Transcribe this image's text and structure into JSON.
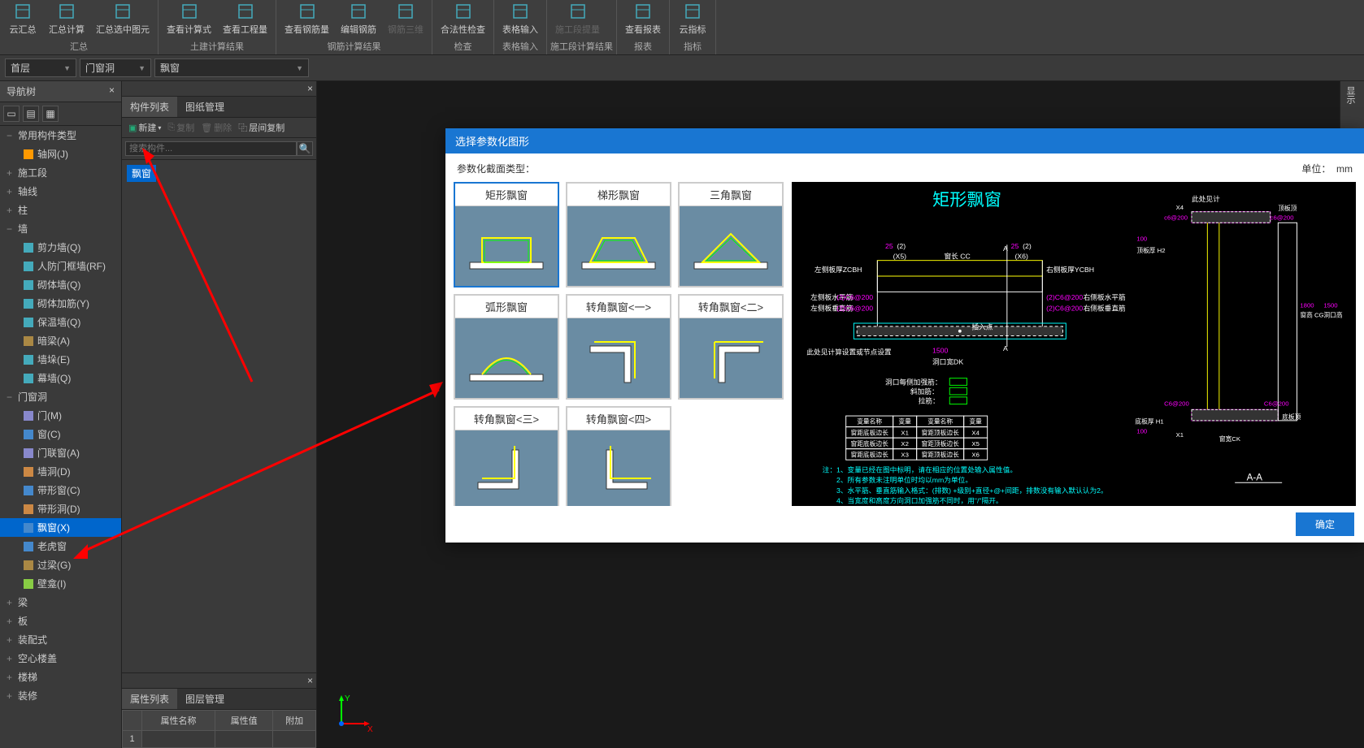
{
  "ribbon": {
    "groups": [
      {
        "label": "汇总",
        "buttons": [
          {
            "label": "云汇总",
            "icon": "cloud"
          },
          {
            "label": "汇总计算",
            "icon": "calc"
          },
          {
            "label": "汇总选中图元",
            "icon": "select"
          }
        ]
      },
      {
        "label": "土建计算结果",
        "buttons": [
          {
            "label": "查看计算式",
            "icon": "view"
          },
          {
            "label": "查看工程量",
            "icon": "view"
          }
        ]
      },
      {
        "label": "钢筋计算结果",
        "buttons": [
          {
            "label": "查看钢筋量",
            "icon": "view"
          },
          {
            "label": "编辑钢筋",
            "icon": "edit"
          },
          {
            "label": "钢筋三维",
            "icon": "3d",
            "disabled": true
          }
        ]
      },
      {
        "label": "检查",
        "buttons": [
          {
            "label": "合法性检查",
            "icon": "check"
          }
        ]
      },
      {
        "label": "表格输入",
        "buttons": [
          {
            "label": "表格输入",
            "icon": "table"
          }
        ]
      },
      {
        "label": "施工段计算结果",
        "buttons": [
          {
            "label": "施工段提量",
            "icon": "phase",
            "disabled": true
          }
        ]
      },
      {
        "label": "报表",
        "buttons": [
          {
            "label": "查看报表",
            "icon": "report"
          }
        ]
      },
      {
        "label": "指标",
        "buttons": [
          {
            "label": "云指标",
            "icon": "cloud"
          }
        ]
      }
    ]
  },
  "selectors": {
    "floor": "首层",
    "category": "门窗洞",
    "component": "飘窗"
  },
  "nav": {
    "title": "导航树",
    "items": [
      {
        "label": "常用构件类型",
        "toggle": "−",
        "lvl": 0
      },
      {
        "label": "轴网(J)",
        "icon": "grid",
        "lvl": 2
      },
      {
        "label": "施工段",
        "toggle": "+",
        "lvl": 0
      },
      {
        "label": "轴线",
        "toggle": "+",
        "lvl": 0
      },
      {
        "label": "柱",
        "toggle": "+",
        "lvl": 0
      },
      {
        "label": "墙",
        "toggle": "−",
        "lvl": 0
      },
      {
        "label": "剪力墙(Q)",
        "icon": "wall",
        "lvl": 2
      },
      {
        "label": "人防门框墙(RF)",
        "icon": "wall",
        "lvl": 2
      },
      {
        "label": "砌体墙(Q)",
        "icon": "wall",
        "lvl": 2
      },
      {
        "label": "砌体加筋(Y)",
        "icon": "wall",
        "lvl": 2
      },
      {
        "label": "保温墙(Q)",
        "icon": "wall",
        "lvl": 2
      },
      {
        "label": "暗梁(A)",
        "icon": "beam",
        "lvl": 2
      },
      {
        "label": "墙垛(E)",
        "icon": "wall",
        "lvl": 2
      },
      {
        "label": "幕墙(Q)",
        "icon": "wall",
        "lvl": 2
      },
      {
        "label": "门窗洞",
        "toggle": "−",
        "lvl": 0
      },
      {
        "label": "门(M)",
        "icon": "door",
        "lvl": 2
      },
      {
        "label": "窗(C)",
        "icon": "window",
        "lvl": 2
      },
      {
        "label": "门联窗(A)",
        "icon": "door",
        "lvl": 2
      },
      {
        "label": "墙洞(D)",
        "icon": "hole",
        "lvl": 2
      },
      {
        "label": "带形窗(C)",
        "icon": "window",
        "lvl": 2
      },
      {
        "label": "带形洞(D)",
        "icon": "hole",
        "lvl": 2
      },
      {
        "label": "飘窗(X)",
        "icon": "window",
        "lvl": 2,
        "selected": true
      },
      {
        "label": "老虎窗",
        "icon": "window",
        "lvl": 2
      },
      {
        "label": "过梁(G)",
        "icon": "beam",
        "lvl": 2
      },
      {
        "label": "壁龛(I)",
        "icon": "niche",
        "lvl": 2
      },
      {
        "label": "梁",
        "toggle": "+",
        "lvl": 0
      },
      {
        "label": "板",
        "toggle": "+",
        "lvl": 0
      },
      {
        "label": "装配式",
        "toggle": "+",
        "lvl": 0
      },
      {
        "label": "空心楼盖",
        "toggle": "+",
        "lvl": 0
      },
      {
        "label": "楼梯",
        "toggle": "+",
        "lvl": 0
      },
      {
        "label": "装修",
        "toggle": "+",
        "lvl": 0
      }
    ]
  },
  "mid": {
    "tabs": [
      "构件列表",
      "图纸管理"
    ],
    "activeTab": 0,
    "tools": {
      "new": "新建",
      "copy": "复制",
      "delete": "删除",
      "floorCopy": "层间复制"
    },
    "searchPlaceholder": "搜索构件...",
    "selectedComponent": "飘窗"
  },
  "prop": {
    "tabs": [
      "属性列表",
      "图层管理"
    ],
    "activeTab": 0,
    "headers": [
      "属性名称",
      "属性值",
      "附加"
    ],
    "rowNum": "1"
  },
  "modal": {
    "title": "选择参数化图形",
    "sectionLabel": "参数化截面类型：",
    "unitLabel": "单位：",
    "unitValue": "mm",
    "shapes": [
      "矩形飘窗",
      "梯形飘窗",
      "三角飘窗",
      "弧形飘窗",
      "转角飘窗<一>",
      "转角飘窗<二>",
      "转角飘窗<三>",
      "转角飘窗<四>"
    ],
    "selectedShape": 0,
    "ok": "确定",
    "preview": {
      "title": "矩形飘窗",
      "labels": {
        "leftPanelThk": "左侧板厚ZCBH",
        "rightPanelThk": "右侧板厚YCBH",
        "leftPanelHBar": "左侧板水平筋",
        "rightPanelHBar": "右侧板水平筋",
        "leftPanelVBar": "左侧板垂直筋",
        "rightPanelVBar": "右侧板垂直筋",
        "winLen": "窗长 CC",
        "openWidth": "洞口宽DK",
        "note1": "此处见计算设置或节点设置",
        "note2": "此处见计",
        "insertPt": "插入点",
        "sideStrBar": "洞口每侧加强筋：",
        "diagBar": "斜加筋：",
        "stirrup": "拉筋：",
        "topPanel": "顶板顶",
        "topPanelThk": "顶板厚 H2",
        "botPanelThk": "底板厚 H1",
        "botPanel": "底板顶",
        "winWidth": "窗宽CK",
        "winHeight": "窗高 CG",
        "openHeight": "洞口高",
        "sectionAA": "A-A"
      },
      "dims": {
        "x25a": "25",
        "x25b": "25",
        "x2a": "(2)",
        "x2b": "(2)",
        "x2c": "(2)",
        "x2d": "(2)",
        "x2e": "(2)",
        "x5": "(X5)",
        "x6": "(X6)",
        "d1500": "1500",
        "d1800": "1800",
        "d100a": "100",
        "d100b": "100",
        "barA": "C6@200",
        "barB": "c6@200",
        "barC": "c6@200",
        "barD": "C6@200",
        "barE": "C6@200",
        "x1": "X1",
        "x4": "X4"
      },
      "table": {
        "headers": [
          "变量名称",
          "变量",
          "变量名称",
          "变量"
        ],
        "rows": [
          [
            "窗距底板边长",
            "X1",
            "窗距顶板边长",
            "X4"
          ],
          [
            "窗距底板边长",
            "X2",
            "窗距顶板边长",
            "X5"
          ],
          [
            "窗距底板边长",
            "X3",
            "窗距顶板边长",
            "X6"
          ]
        ]
      },
      "notes": [
        "注：1、变量已经在图中标明，请在相应的位置处输入属性值。",
        "2、所有参数未注明单位时均以mm为单位。",
        "3、水平筋、垂直筋输入格式：(排数) +级别+直径+@+间距，排数没有输入默认认为2。",
        "4、当宽度和高度方向洞口加强筋不同时，用\"/\"隔开。"
      ]
    }
  },
  "rightBar": {
    "label": "显示"
  },
  "axis": {
    "x": "X",
    "y": "Y"
  }
}
